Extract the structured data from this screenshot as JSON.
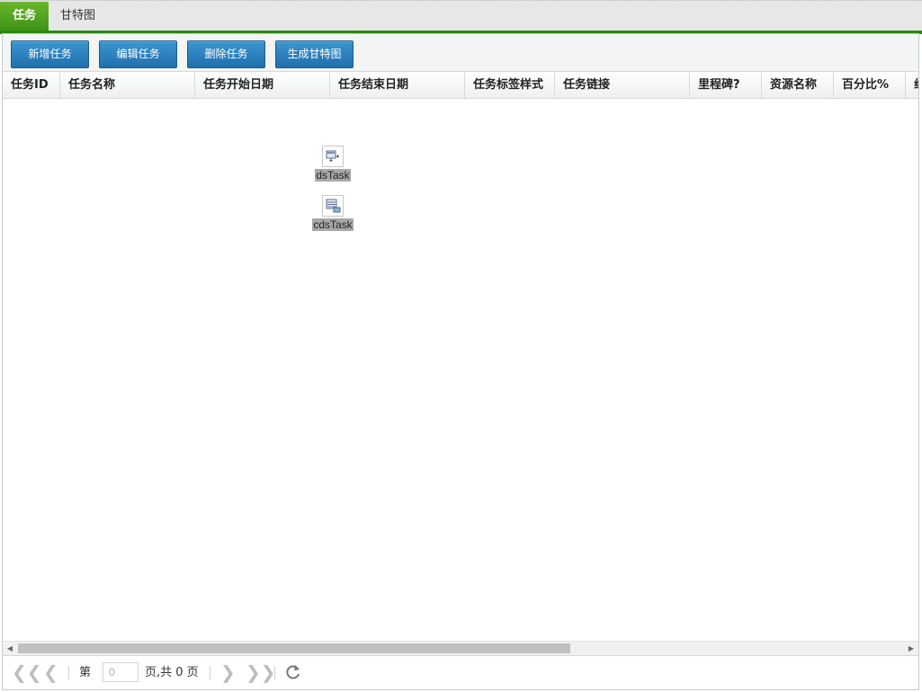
{
  "tabs": [
    {
      "label": "任务",
      "active": true
    },
    {
      "label": "甘特图",
      "active": false
    }
  ],
  "toolbar": {
    "buttons": [
      {
        "label": "新增任务"
      },
      {
        "label": "编辑任务"
      },
      {
        "label": "删除任务"
      },
      {
        "label": "生成甘特图"
      }
    ]
  },
  "grid": {
    "columns": [
      "任务ID",
      "任务名称",
      "任务开始日期",
      "任务结束日期",
      "任务标签样式",
      "任务链接",
      "里程碑?",
      "资源名称",
      "百分比%",
      "组"
    ],
    "rows": []
  },
  "datasources": [
    {
      "label": "dsTask",
      "icon": "dataset-icon"
    },
    {
      "label": "cdsTask",
      "icon": "client-dataset-icon"
    }
  ],
  "pager": {
    "page_prefix": "第",
    "page_value": "0",
    "page_suffix": "页,共 0 页"
  },
  "colors": {
    "tab_active": "#4a9c1c",
    "tab_line": "#2a8a12",
    "button": "#2576b6"
  }
}
